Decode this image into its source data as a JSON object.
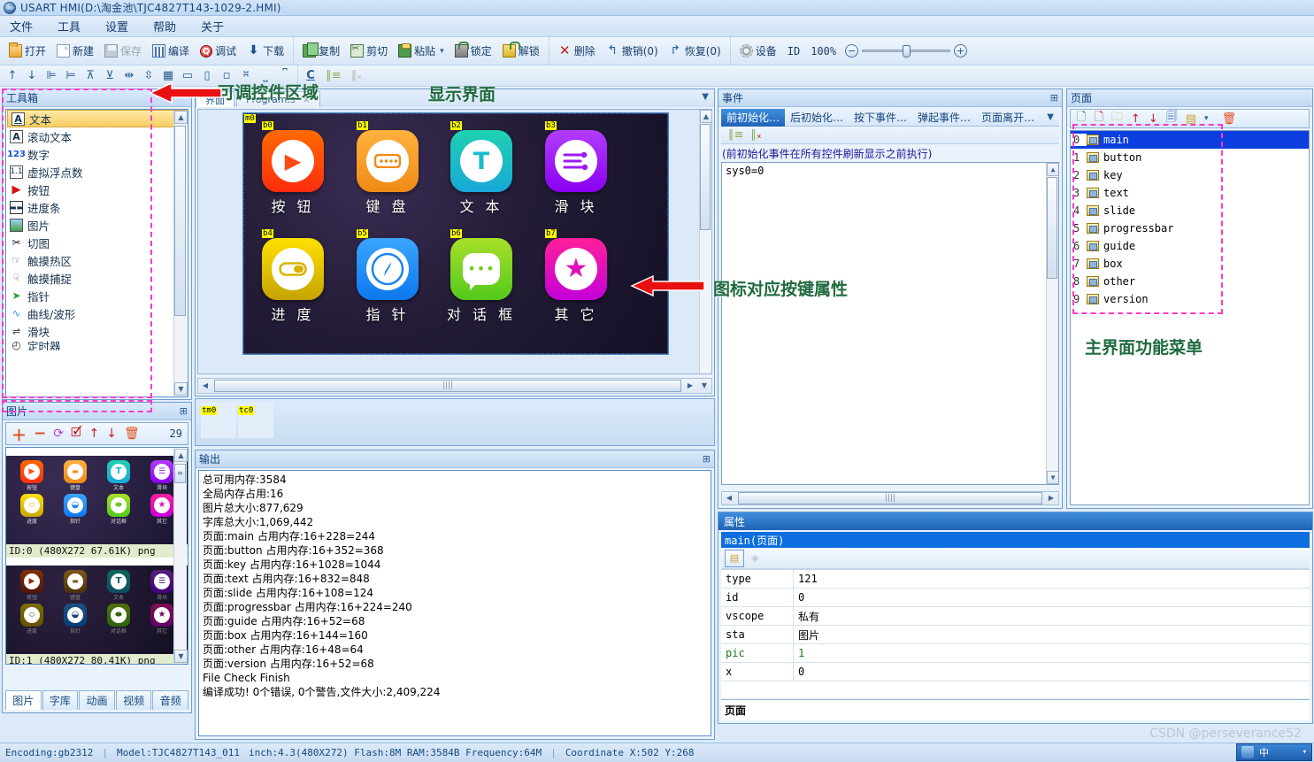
{
  "window": {
    "title": "USART HMI(D:\\淘金池\\TJC4827T143-1029-2.HMI)",
    "icon": "globe-icon"
  },
  "menubar": {
    "items": [
      "文件",
      "工具",
      "设置",
      "帮助",
      "关于"
    ]
  },
  "toolbar1": {
    "groups": [
      {
        "items": [
          {
            "label": "打开",
            "icon": "folder-open-icon",
            "disabled": false
          },
          {
            "label": "新建",
            "icon": "new-file-icon",
            "disabled": false
          },
          {
            "label": "保存",
            "icon": "save-icon",
            "disabled": true
          },
          {
            "label": "编译",
            "icon": "compile-icon",
            "disabled": false
          },
          {
            "label": "调试",
            "icon": "debug-icon",
            "disabled": false
          },
          {
            "label": "下载",
            "icon": "download-icon",
            "disabled": false
          }
        ]
      },
      {
        "items": [
          {
            "label": "复制",
            "icon": "copy-icon",
            "disabled": false
          },
          {
            "label": "剪切",
            "icon": "cut-icon",
            "disabled": false
          },
          {
            "label": "粘贴",
            "icon": "paste-icon",
            "disabled": false
          },
          {
            "label": "锁定",
            "icon": "lock-icon",
            "disabled": false
          },
          {
            "label": "解锁",
            "icon": "unlock-icon",
            "disabled": false
          }
        ]
      },
      {
        "items": [
          {
            "label": "删除",
            "icon": "delete-x-icon",
            "disabled": false
          },
          {
            "label": "撤销(0)",
            "icon": "undo-icon",
            "disabled": false
          },
          {
            "label": "恢复(0)",
            "icon": "redo-icon",
            "disabled": false
          }
        ]
      },
      {
        "items": [
          {
            "label": "设备",
            "icon": "gear-icon",
            "disabled": false
          }
        ]
      }
    ],
    "paste_dropdown": "▾",
    "id_label": "ID",
    "zoom_label": "100%",
    "zoom_out": "−",
    "zoom_in": "+"
  },
  "toolbar2": {
    "align_items": [
      "align-top-icon",
      "align-bottom-icon",
      "align-left-icon",
      "align-right-icon",
      "align-center-v-icon",
      "align-middle-h-icon",
      "center-horizontal-icon",
      "center-vertical-icon",
      "grid-icon",
      "same-width-icon",
      "same-height-icon",
      "same-size-icon",
      "distribute-h-icon",
      "distribute-v-top-icon",
      "distribute-v-bottom-icon"
    ],
    "text_items": [
      "C",
      "comment-icon",
      "uncomment-icon"
    ]
  },
  "toolbox": {
    "title": "工具箱",
    "items": [
      {
        "label": "文本",
        "icon": "text-a-icon",
        "selected": true
      },
      {
        "label": "滚动文本",
        "icon": "scroll-text-icon",
        "selected": false
      },
      {
        "label": "数字",
        "icon": "number-123-icon",
        "selected": false
      },
      {
        "label": "虚拟浮点数",
        "icon": "float-1-1-icon",
        "selected": false
      },
      {
        "label": "按钮",
        "icon": "button-play-icon",
        "selected": false
      },
      {
        "label": "进度条",
        "icon": "progressbar-icon",
        "selected": false
      },
      {
        "label": "图片",
        "icon": "picture-icon",
        "selected": false
      },
      {
        "label": "切图",
        "icon": "crop-scissors-icon",
        "selected": false
      },
      {
        "label": "触摸热区",
        "icon": "touch-hotspot-icon",
        "selected": false
      },
      {
        "label": "触摸捕捉",
        "icon": "touch-capture-icon",
        "selected": false
      },
      {
        "label": "指针",
        "icon": "pointer-cursor-icon",
        "selected": false
      },
      {
        "label": "曲线/波形",
        "icon": "waveform-icon",
        "selected": false
      },
      {
        "label": "滑块",
        "icon": "slider-icon",
        "selected": false
      },
      {
        "label": "定时器",
        "icon": "timer-clock-icon",
        "selected": false
      }
    ]
  },
  "picture_panel": {
    "title": "图片",
    "pin": "pin-icon",
    "toolbar": [
      "add-icon",
      "remove-icon",
      "refresh-icon",
      "edit-icon",
      "move-up-icon",
      "move-down-icon",
      "delete-icon"
    ],
    "count": "29",
    "items": [
      {
        "caption": "ID:0  (480X272 67.61K) png"
      },
      {
        "caption": "ID:1  (480X272 80.41K) png"
      }
    ],
    "tabs": [
      {
        "label": "图片",
        "active": true
      },
      {
        "label": "字库",
        "active": false
      },
      {
        "label": "动画",
        "active": false
      },
      {
        "label": "视频",
        "active": false
      },
      {
        "label": "音频",
        "active": false
      }
    ]
  },
  "editor": {
    "tabs": [
      {
        "label": "界面",
        "active": true
      },
      {
        "label": "Program.s",
        "active": false,
        "close": "×"
      }
    ],
    "dropdown_icon": "chevron-down-icon",
    "page_tag": "m0",
    "tiles": [
      {
        "tag": "b0",
        "label": "按 钮",
        "color1": "#ff6a00",
        "color2": "#ff2d0f",
        "glyph": "play"
      },
      {
        "tag": "b1",
        "label": "键 盘",
        "color1": "#ffb23e",
        "color2": "#f08a16",
        "glyph": "keyboard"
      },
      {
        "tag": "b2",
        "label": "文 本",
        "color1": "#1fd1b0",
        "color2": "#18a8d8",
        "glyph": "T"
      },
      {
        "tag": "b3",
        "label": "滑 块",
        "color1": "#b23cff",
        "color2": "#8a00f0",
        "glyph": "slider"
      },
      {
        "tag": "b4",
        "label": "进 度",
        "color1": "#ffe000",
        "color2": "#c9a800",
        "glyph": "toggle"
      },
      {
        "tag": "b5",
        "label": "指 针",
        "color1": "#3aa5ff",
        "color2": "#0d78ef",
        "glyph": "compass"
      },
      {
        "tag": "b6",
        "label": "对 话 框",
        "color1": "#a8e02a",
        "color2": "#53c91b",
        "glyph": "chat"
      },
      {
        "tag": "b7",
        "label": "其 它",
        "color1": "#ff1f9b",
        "color2": "#c400d8",
        "glyph": "star"
      }
    ],
    "hscroll_grip": "||||"
  },
  "timers": {
    "chips": [
      "tm0",
      "tc0"
    ]
  },
  "output": {
    "title": "输出",
    "pin": "pin-icon",
    "lines": [
      "总可用内存:3584",
      "全局内存占用:16",
      "图片总大小:877,629",
      "字库总大小:1,069,442",
      "页面:main 占用内存:16+228=244",
      "页面:button 占用内存:16+352=368",
      "页面:key 占用内存:16+1028=1044",
      "页面:text 占用内存:16+832=848",
      "页面:slide 占用内存:16+108=124",
      "页面:progressbar 占用内存:16+224=240",
      "页面:guide 占用内存:16+52=68",
      "页面:box 占用内存:16+144=160",
      "页面:other 占用内存:16+48=64",
      "页面:version 占用内存:16+52=68",
      "File Check Finish",
      "编译成功! 0个错误, 0个警告,文件大小:2,409,224"
    ]
  },
  "events": {
    "title": "事件",
    "pin": "pin-icon",
    "tabs": [
      {
        "label": "前初始化…",
        "active": true
      },
      {
        "label": "后初始化…",
        "active": false
      },
      {
        "label": "按下事件…",
        "active": false
      },
      {
        "label": "弹起事件…",
        "active": false
      },
      {
        "label": "页面离开…",
        "active": false
      }
    ],
    "more": "chevron-down-icon",
    "tools": [
      "comment-lines-icon",
      "remove-comment-icon"
    ],
    "hint": "(前初始化事件在所有控件刷新显示之前执行)",
    "code": "sys0=0"
  },
  "pages": {
    "title": "页面",
    "tools": [
      "new-page-icon",
      "delete-page-icon",
      "import-page-icon",
      "move-up-icon",
      "move-down-icon",
      "copy-page-icon",
      "page-settings-icon",
      "dropdown-icon",
      "trash-icon"
    ],
    "items": [
      {
        "index": "0",
        "name": "main",
        "selected": true
      },
      {
        "index": "1",
        "name": "button",
        "selected": false
      },
      {
        "index": "2",
        "name": "key",
        "selected": false
      },
      {
        "index": "3",
        "name": "text",
        "selected": false
      },
      {
        "index": "4",
        "name": "slide",
        "selected": false
      },
      {
        "index": "5",
        "name": "progressbar",
        "selected": false
      },
      {
        "index": "6",
        "name": "guide",
        "selected": false
      },
      {
        "index": "7",
        "name": "box",
        "selected": false
      },
      {
        "index": "8",
        "name": "other",
        "selected": false
      },
      {
        "index": "9",
        "name": "version",
        "selected": false
      }
    ]
  },
  "properties": {
    "title": "属性",
    "object": "main(页面)",
    "tools": [
      "properties-view-icon",
      "events-view-icon"
    ],
    "rows": [
      {
        "key": "type",
        "value": "121",
        "green": false
      },
      {
        "key": "id",
        "value": "0",
        "green": false
      },
      {
        "key": "vscope",
        "value": "私有",
        "green": false
      },
      {
        "key": "sta",
        "value": "图片",
        "green": false
      },
      {
        "key": "pic",
        "value": "1",
        "green": true
      },
      {
        "key": "x",
        "value": "0",
        "green": false
      }
    ],
    "footer": "页面"
  },
  "statusbar": {
    "encoding": "Encoding:gb2312",
    "model": "Model:TJC4827T143_011",
    "specs": "inch:4.3(480X272) Flash:8M RAM:3584B Frequency:64M",
    "coordinate": "Coordinate X:502  Y:268"
  },
  "annotations": [
    {
      "text": "可调控件区域",
      "id": "anno-toolbox"
    },
    {
      "text": "显示界面",
      "id": "anno-display"
    },
    {
      "text": "图标对应按键属性",
      "id": "anno-icon-props"
    },
    {
      "text": "主界面功能菜单",
      "id": "anno-page-menu"
    }
  ],
  "watermark": "CSDN @perseverance52",
  "ime": {
    "mode": "中",
    "icon": "ime-icon"
  }
}
